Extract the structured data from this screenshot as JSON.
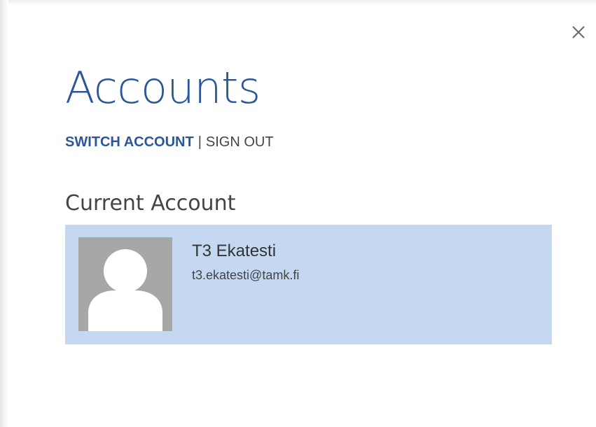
{
  "dialog": {
    "title": "Accounts",
    "close_icon": "close-icon"
  },
  "links": {
    "switch_account": "SWITCH ACCOUNT",
    "separator": "|",
    "sign_out": "SIGN OUT"
  },
  "current_account": {
    "heading": "Current Account",
    "name": "T3 Ekatesti",
    "email": "t3.ekatesti@tamk.fi",
    "avatar_icon": "default-user-avatar-icon"
  },
  "colors": {
    "accent": "#2b579a",
    "card_background": "#c5d8f1",
    "avatar_background": "#a7a7a7",
    "text": "#444444"
  }
}
